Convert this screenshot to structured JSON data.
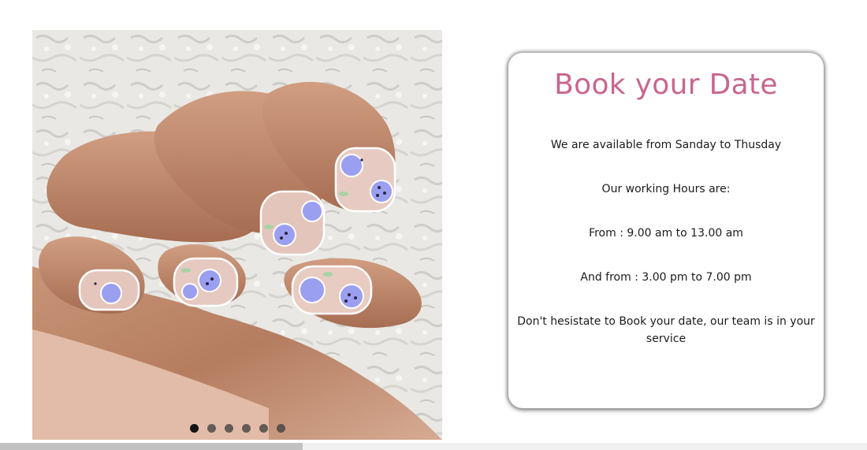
{
  "carousel": {
    "image_alt": "Hand with blueberry nail art",
    "slide_count": 6,
    "active_index": 0
  },
  "booking": {
    "title": "Book your Date",
    "lines": [
      "We are available from Sanday to Thusday",
      "Our working Hours are:",
      "From : 9.00 am to 13.00 am",
      "And from : 3.00 pm to 7.00 pm",
      "Don't hesistate to Book your date, our team is in your service"
    ]
  },
  "colors": {
    "title": "#c9668f",
    "text": "#1b1b1b",
    "dot_active": "#141414",
    "dot": "#3b3b3b"
  }
}
